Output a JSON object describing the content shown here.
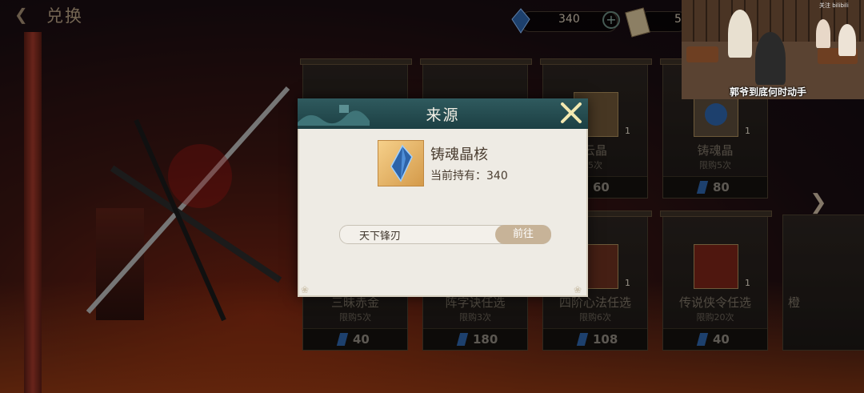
{
  "header": {
    "back_icon": "back-arrow-icon",
    "title": "兑换",
    "resources": [
      {
        "icon": "crystal-icon",
        "value": "340"
      },
      {
        "icon": "ticket-icon",
        "value": "5"
      }
    ]
  },
  "cards_row1": [
    {
      "name": "",
      "limit": "",
      "price": ""
    },
    {
      "name": "",
      "limit": "",
      "price": ""
    },
    {
      "name": "云晶",
      "limit": "5次",
      "price": "60",
      "qty": "1"
    },
    {
      "name": "铸魂晶",
      "limit": "限购5次",
      "price": "80",
      "qty": "1"
    }
  ],
  "cards_row2": [
    {
      "name": "三昧赤金",
      "limit": "限购5次",
      "price": "40"
    },
    {
      "name": "阵字诀任选",
      "limit": "限购3次",
      "price": "180"
    },
    {
      "name": "四阶心法任选",
      "limit": "限购6次",
      "price": "108",
      "qty": "1"
    },
    {
      "name": "传说侠令任选",
      "limit": "限购20次",
      "price": "40",
      "qty": "1"
    },
    {
      "name": "橙"
    }
  ],
  "overlay": {
    "caption": "郭爷到底何时动手",
    "tag": "关注 bilibili"
  },
  "modal": {
    "title": "来源",
    "item_name": "铸魂晶核",
    "owned_text": "当前持有：340",
    "source_label": "天下锋刃",
    "go_label": "前往"
  },
  "colors": {
    "modal_header": "#1c3f43",
    "go_button": "#c7b398",
    "crystal": "#2d63a8"
  }
}
